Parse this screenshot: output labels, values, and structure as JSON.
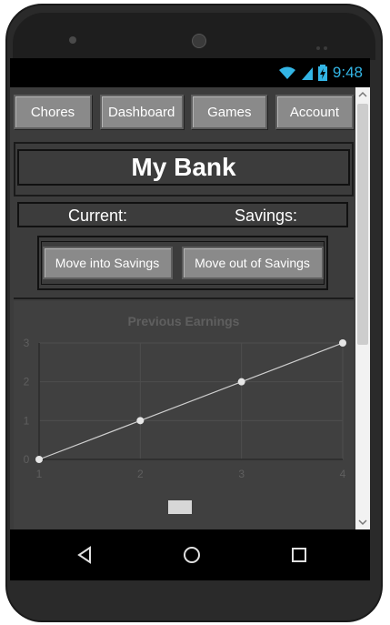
{
  "status_bar": {
    "time": "9:48",
    "icons": [
      "wifi-icon",
      "cell-signal-icon",
      "battery-charging-icon"
    ]
  },
  "nav": {
    "tabs": [
      {
        "label": "Chores"
      },
      {
        "label": "Dashboard"
      },
      {
        "label": "Games"
      },
      {
        "label": "Account"
      }
    ]
  },
  "header": {
    "title": "My Bank"
  },
  "balances": {
    "current_label": "Current:",
    "savings_label": "Savings:"
  },
  "actions": {
    "move_into_savings": "Move into Savings",
    "move_out_of_savings": "Move out of Savings"
  },
  "chart_data": {
    "type": "line",
    "title": "Previous Earnings",
    "x": [
      1,
      2,
      3,
      4
    ],
    "series": [
      {
        "values": [
          0,
          1,
          2,
          3
        ]
      }
    ],
    "xlim": [
      1,
      4
    ],
    "ylim": [
      0,
      3
    ],
    "x_ticks": [
      "1",
      "2",
      "3",
      "4"
    ],
    "y_ticks": [
      "0",
      "1",
      "2",
      "3"
    ],
    "grid": true,
    "legend": "bottom",
    "colors": {
      "line": "#cfcfcf",
      "point": "#e6e6e6",
      "grid": "#4e4e4e",
      "axis": "#2a2a2a",
      "tick_label": "#5f5f5f"
    }
  },
  "system_nav": {
    "icons": [
      "back-icon",
      "home-icon",
      "recents-icon"
    ]
  },
  "colors": {
    "app_background": "#3c3c3c",
    "button": "#8a8a8a",
    "accent": "#33b5e5"
  }
}
